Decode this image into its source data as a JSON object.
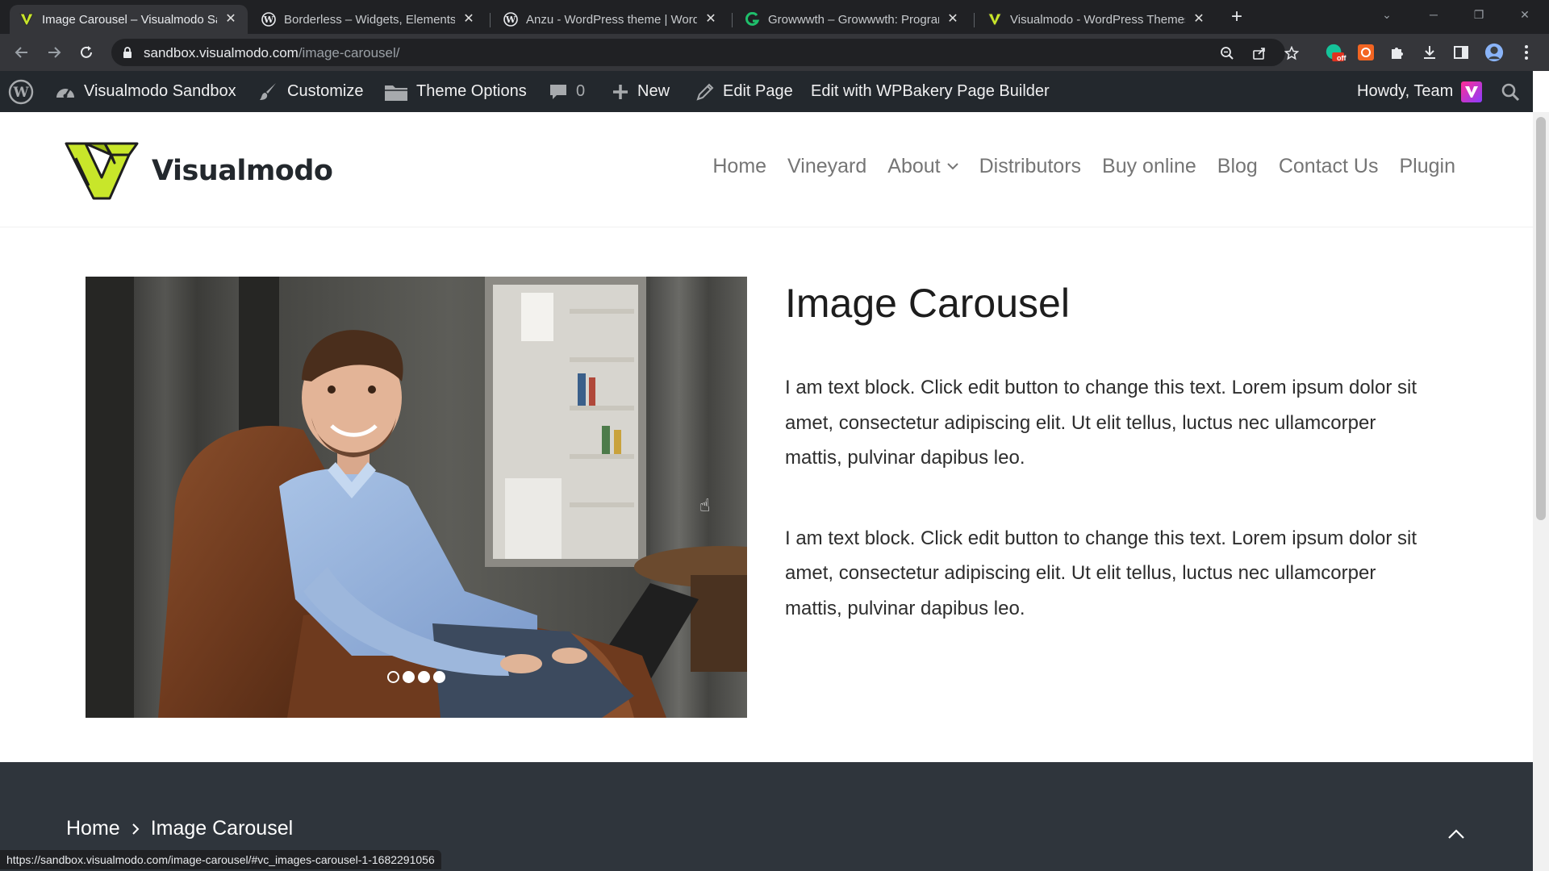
{
  "browser": {
    "tabs": [
      {
        "title": "Image Carousel – Visualmodo Sandbox",
        "icon": "visualmodo-favicon-icon",
        "active": true
      },
      {
        "title": "Borderless – Widgets, Elements, Templates",
        "icon": "wordpress-favicon-icon",
        "active": false
      },
      {
        "title": "Anzu - WordPress theme | WordPress.org",
        "icon": "wordpress-favicon-icon",
        "active": false
      },
      {
        "title": "Growwwth – Growwwth: Programs",
        "icon": "growwwth-favicon-icon",
        "active": false
      },
      {
        "title": "Visualmodo - WordPress Themes",
        "icon": "visualmodo-favicon-icon",
        "active": false
      }
    ],
    "address": {
      "host": "sandbox.visualmodo.com",
      "path": "/image-carousel/"
    },
    "status_url": "https://sandbox.visualmodo.com/image-carousel/#vc_images-carousel-1-1682291056",
    "extension_badge": "off"
  },
  "admin_bar": {
    "site_name": "Visualmodo Sandbox",
    "customize": "Customize",
    "theme_options": "Theme Options",
    "comments_count": "0",
    "new": "New",
    "edit_page": "Edit Page",
    "edit_with": "Edit with WPBakery Page Builder",
    "howdy": "Howdy, Team"
  },
  "site": {
    "logo_text": "Visualmodo",
    "accent_color": "#c8e62a",
    "nav": [
      "Home",
      "Vineyard",
      "About",
      "Distributors",
      "Buy online",
      "Blog",
      "Contact Us",
      "Plugin"
    ]
  },
  "page": {
    "title": "Image Carousel",
    "paragraphs": [
      "I am text block. Click edit button to change this text. Lorem ipsum dolor sit amet, consectetur adipiscing elit. Ut elit tellus, luctus nec ullamcorper mattis, pulvinar dapibus leo.",
      "I am text block. Click edit button to change this text. Lorem ipsum dolor sit amet, consectetur adipiscing elit. Ut elit tellus, luctus nec ullamcorper mattis, pulvinar dapibus leo."
    ],
    "carousel": {
      "slide_count": 4,
      "active_slide": 1
    }
  },
  "footer": {
    "breadcrumb": [
      "Home",
      "Image Carousel"
    ]
  }
}
